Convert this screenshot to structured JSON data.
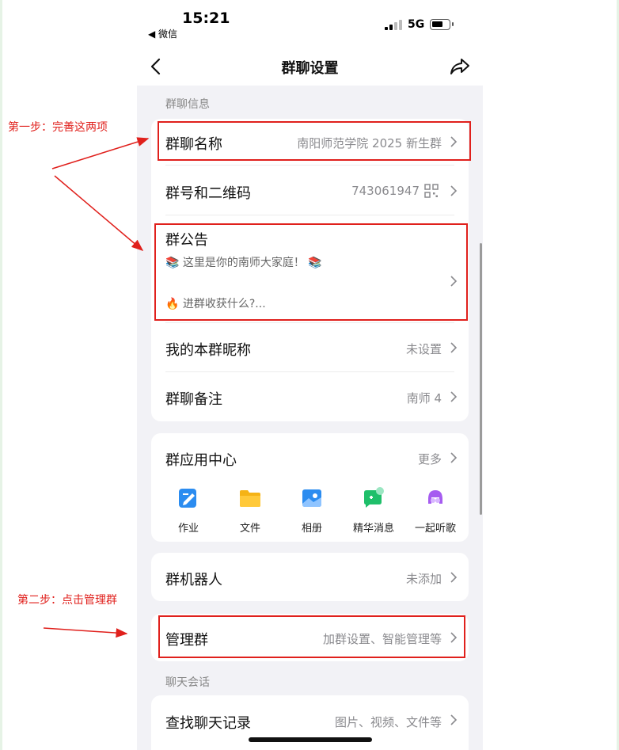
{
  "status_bar": {
    "time": "15:21",
    "back_app": "◀ 微信",
    "network": "5G"
  },
  "nav": {
    "title": "群聊设置"
  },
  "sections": {
    "group_info": "群聊信息",
    "chat": "聊天会话"
  },
  "rows": {
    "group_name": {
      "label": "群聊名称",
      "value": "南阳师范学院 2025 新生群"
    },
    "group_number": {
      "label": "群号和二维码",
      "value": "743061947"
    },
    "announcement": {
      "label": "群公告",
      "line1": "📚 这里是你的南师大家庭！ 📚",
      "line2": "🔥 进群收获什么?..."
    },
    "my_nickname": {
      "label": "我的本群昵称",
      "value": "未设置"
    },
    "group_note": {
      "label": "群聊备注",
      "value": "南师 4"
    },
    "app_center": {
      "label": "群应用中心",
      "value": "更多"
    },
    "bot": {
      "label": "群机器人",
      "value": "未添加"
    },
    "manage": {
      "label": "管理群",
      "value": "加群设置、智能管理等"
    },
    "search_history": {
      "label": "查找聊天记录",
      "value": "图片、视频、文件等"
    }
  },
  "apps": [
    {
      "label": "作业",
      "icon": "homework-icon"
    },
    {
      "label": "文件",
      "icon": "folder-icon"
    },
    {
      "label": "相册",
      "icon": "album-icon"
    },
    {
      "label": "精华消息",
      "icon": "featured-message-icon"
    },
    {
      "label": "一起听歌",
      "icon": "listen-together-icon"
    }
  ],
  "annotations": {
    "step1": "第一步：完善这两项",
    "step2": "第二步：点击管理群"
  },
  "colors": {
    "highlight": "#e0201c",
    "background": "#f2f2f6"
  }
}
